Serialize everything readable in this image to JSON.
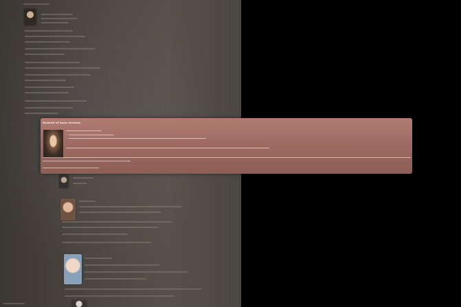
{
  "card": {
    "name": "Portrait of Isaac Newton",
    "subtitle": "",
    "lines": [
      "",
      "",
      "",
      "",
      "",
      "",
      ""
    ]
  },
  "colors": {
    "card_top": "#b07c72",
    "card_bottom": "#8b5f57",
    "background": "#000000",
    "blurred_page": "#4a4541"
  },
  "icons": {
    "portrait": "portrait-image-icon"
  }
}
